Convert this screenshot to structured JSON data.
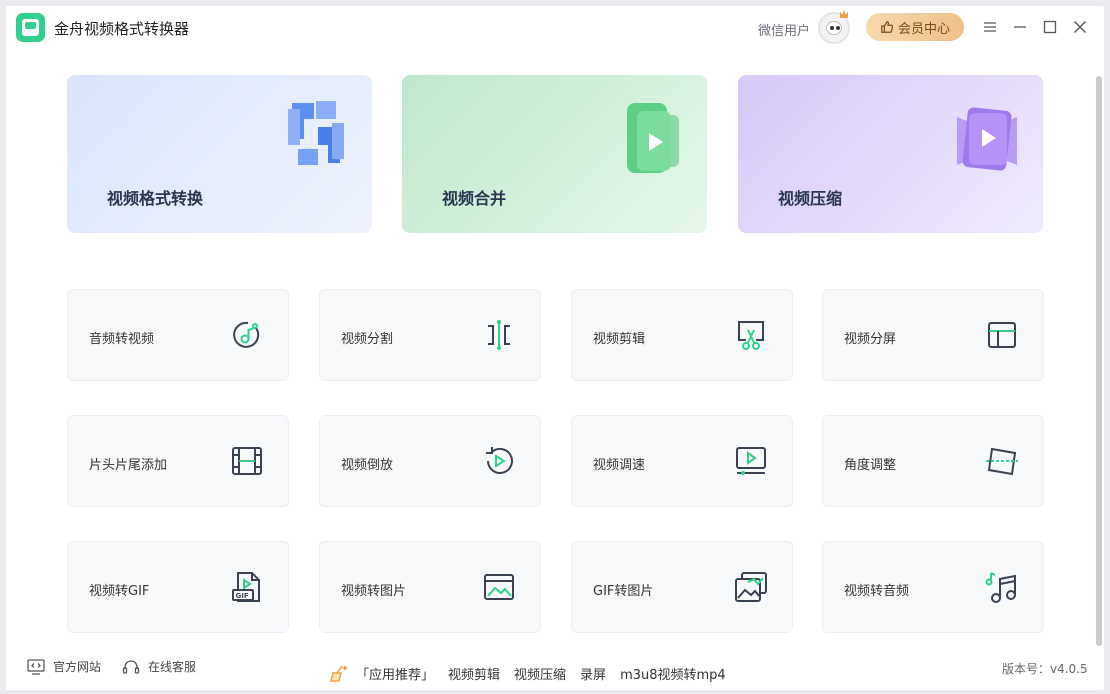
{
  "app": {
    "title": "金舟视频格式转换器",
    "user_name": "微信用户",
    "vip_label": "会员中心"
  },
  "icons": {
    "app_logo": "app-logo-icon",
    "vip": "thumbs-up-icon",
    "menu": "menu-icon",
    "minimize": "minimize-icon",
    "maximize": "maximize-icon",
    "close": "close-icon"
  },
  "hero_cards": [
    {
      "label": "视频格式转换",
      "icon": "format-convert-icon"
    },
    {
      "label": "视频合并",
      "icon": "video-merge-icon"
    },
    {
      "label": "视频压缩",
      "icon": "video-compress-icon"
    }
  ],
  "tools": [
    {
      "label": "音频转视频",
      "icon": "audio-to-video-icon"
    },
    {
      "label": "视频分割",
      "icon": "video-split-icon"
    },
    {
      "label": "视频剪辑",
      "icon": "video-edit-scissors-icon"
    },
    {
      "label": "视频分屏",
      "icon": "split-screen-icon"
    },
    {
      "label": "片头片尾添加",
      "icon": "film-strip-icon"
    },
    {
      "label": "视频倒放",
      "icon": "reverse-play-icon"
    },
    {
      "label": "视频调速",
      "icon": "speed-monitor-icon"
    },
    {
      "label": "角度调整",
      "icon": "rotate-angle-icon"
    },
    {
      "label": "视频转GIF",
      "icon": "gif-file-icon"
    },
    {
      "label": "视频转图片",
      "icon": "image-icon"
    },
    {
      "label": "GIF转图片",
      "icon": "gif-to-image-icon"
    },
    {
      "label": "视频转音频",
      "icon": "music-note-icon"
    }
  ],
  "footer": {
    "website": "官方网站",
    "support": "在线客服",
    "recommend_label": "「应用推荐」",
    "recommend_links": [
      "视频剪辑",
      "视频压缩",
      "录屏",
      "m3u8视频转mp4"
    ],
    "version": "版本号：v4.0.5"
  },
  "colors": {
    "accent": "#2fd18c",
    "icon_dark": "#3a4150",
    "hero_blue": "#dfe8fb",
    "hero_green": "#cdeed8",
    "hero_purple": "#e3d9fb"
  }
}
